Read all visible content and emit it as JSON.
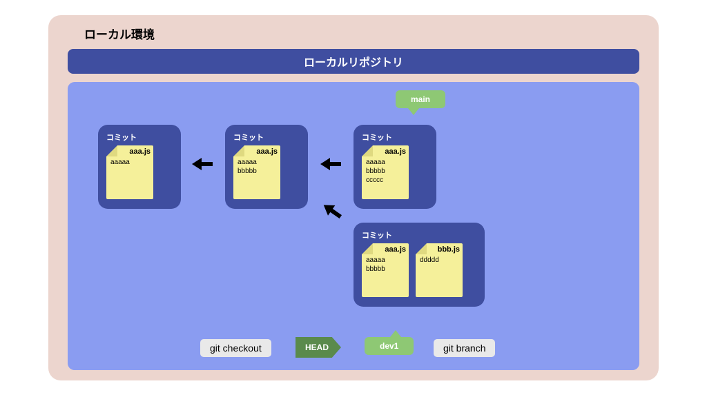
{
  "outer_title": "ローカル環境",
  "repo_title": "ローカルリポジトリ",
  "branches": {
    "main": "main",
    "dev1": "dev1"
  },
  "commit_label": "コミット",
  "commits": {
    "c1": {
      "files": [
        {
          "name": "aaa.js",
          "body": "aaaaa"
        }
      ]
    },
    "c2": {
      "files": [
        {
          "name": "aaa.js",
          "body": "aaaaa\nbbbbb"
        }
      ]
    },
    "c3": {
      "files": [
        {
          "name": "aaa.js",
          "body": "aaaaa\nbbbbb\nccccc"
        }
      ]
    },
    "c4": {
      "files": [
        {
          "name": "aaa.js",
          "body": "aaaaa\nbbbbb"
        },
        {
          "name": "bbb.js",
          "body": "ddddd"
        }
      ]
    }
  },
  "cmd_checkout": "git checkout",
  "cmd_branch": "git branch",
  "head_label": "HEAD"
}
